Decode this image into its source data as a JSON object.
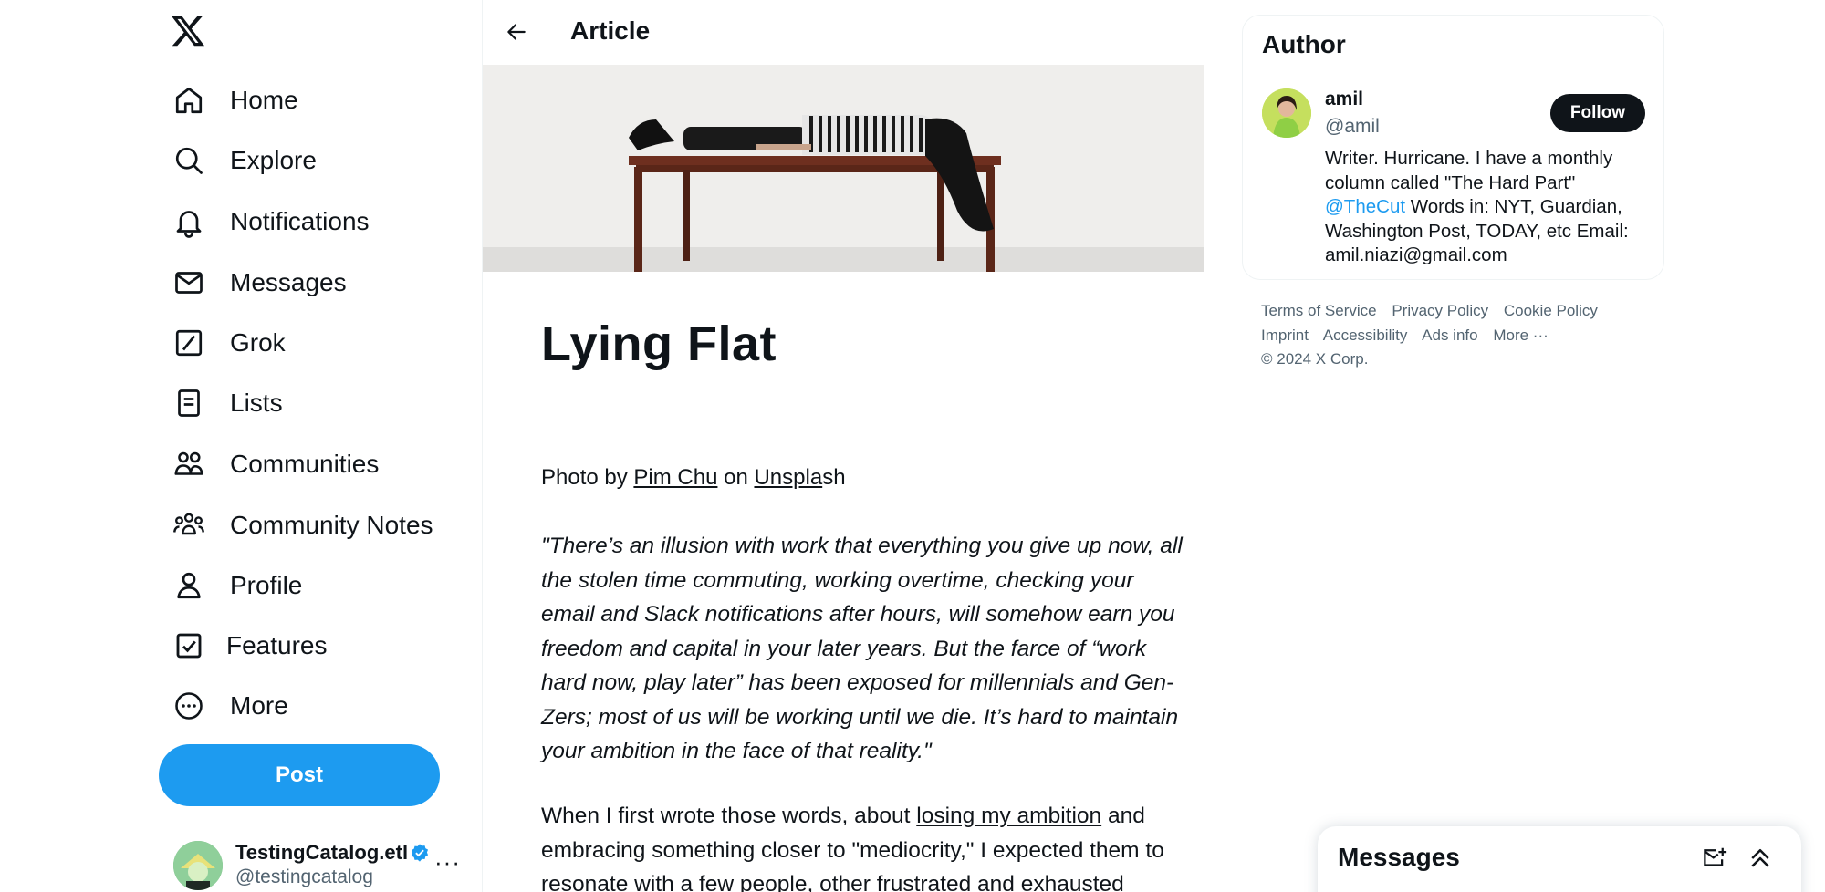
{
  "nav": {
    "items": [
      {
        "label": "Home",
        "icon": "home-icon"
      },
      {
        "label": "Explore",
        "icon": "search-icon"
      },
      {
        "label": "Notifications",
        "icon": "bell-icon"
      },
      {
        "label": "Messages",
        "icon": "envelope-icon"
      },
      {
        "label": "Grok",
        "icon": "grok-icon"
      },
      {
        "label": "Lists",
        "icon": "list-icon"
      },
      {
        "label": "Communities",
        "icon": "communities-icon"
      },
      {
        "label": "Community Notes",
        "icon": "community-notes-icon"
      },
      {
        "label": "Profile",
        "icon": "person-icon"
      },
      {
        "label": "Features",
        "icon": "checkbox-icon"
      },
      {
        "label": "More",
        "icon": "more-circle-icon"
      }
    ],
    "post_label": "Post"
  },
  "account": {
    "name": "TestingCatalog.etl",
    "handle": "@testingcatalog",
    "more": "···"
  },
  "header": {
    "title": "Article"
  },
  "article": {
    "title": "Lying Flat",
    "credit": {
      "prefix": "Photo by ",
      "author": "Pim Chu",
      "middle": " on ",
      "source_linked": "Unspla",
      "source_rest": "sh"
    },
    "quote_lines": [
      "\"There’s an illusion with work that everything you give up now, all",
      "the stolen time commuting, working overtime, checking your",
      "email and Slack notifications after hours, will somehow earn you",
      "freedom and capital in your later years. But the farce of “work",
      "hard now, play later” has been exposed for millennials and Gen-",
      "Zers; most of us will be working until we die. It’s hard to maintain",
      "your ambition in the face of that reality.\""
    ],
    "body": {
      "line1_prefix": "When I first wrote those words, about ",
      "line1_link": "losing my ambition",
      "line1_suffix": " and",
      "line2": "embracing something closer to \"mediocrity,\" I expected them to",
      "line3": "resonate with a few people, other frustrated and exhausted"
    }
  },
  "author": {
    "heading": "Author",
    "name": "amil",
    "handle": "@amil",
    "follow_label": "Follow",
    "bio": {
      "line1": "Writer. Hurricane. I have a monthly",
      "line2": "column called \"The Hard Part\"",
      "mention": "@TheCut",
      "line3_rest": " Words in: NYT, Guardian,",
      "line4": "Washington Post, TODAY, etc Email:",
      "line5": "amil.niazi@gmail.com"
    }
  },
  "footer": {
    "row1": [
      "Terms of Service",
      "Privacy Policy",
      "Cookie Policy"
    ],
    "row2": [
      "Imprint",
      "Accessibility",
      "Ads info",
      "More ···"
    ],
    "copyright": "© 2024 X Corp."
  },
  "messages_drawer": {
    "title": "Messages"
  },
  "colors": {
    "accent": "#1d9bf0",
    "text": "#0f1419",
    "muted": "#536471",
    "border": "#eff3f4"
  }
}
